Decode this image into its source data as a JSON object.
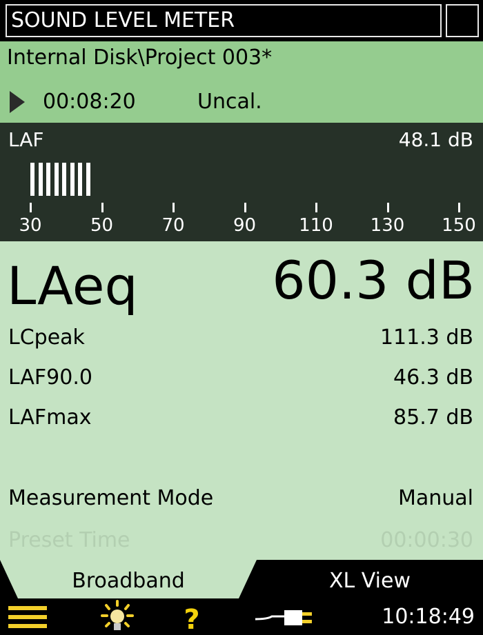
{
  "title": "SOUND LEVEL METER",
  "header": {
    "project_path": "Internal Disk\\Project 003*",
    "elapsed_time": "00:08:20",
    "calibration_status": "Uncal."
  },
  "meter": {
    "parameter": "LAF",
    "value": "48.1 dB",
    "scale_min": 30,
    "scale_max": 150,
    "level_db": 48.1,
    "scale_labels": [
      "30",
      "50",
      "70",
      "90",
      "110",
      "130",
      "150"
    ]
  },
  "main_reading": {
    "label": "LAeq",
    "value": "60.3 dB"
  },
  "readings": [
    {
      "label": "LCpeak",
      "value": "111.3 dB"
    },
    {
      "label": "LAF90.0",
      "value": "46.3 dB"
    },
    {
      "label": "LAFmax",
      "value": "85.7 dB"
    }
  ],
  "settings": [
    {
      "label": "Measurement Mode",
      "value": "Manual",
      "enabled": true
    },
    {
      "label": "Preset Time",
      "value": "00:00:30",
      "enabled": false
    }
  ],
  "tabs": [
    {
      "label": "Broadband",
      "active": true
    },
    {
      "label": "XL View",
      "active": false
    }
  ],
  "bottom_bar": {
    "icons": [
      "menu-icon",
      "backlight-icon",
      "help-icon",
      "power-plug-icon"
    ],
    "time": "10:18:49"
  },
  "colors": {
    "header_green": "#95cc8f",
    "panel_green": "#c5e3c3",
    "meter_dark": "#263128",
    "help_yellow": "#f4d20c"
  }
}
